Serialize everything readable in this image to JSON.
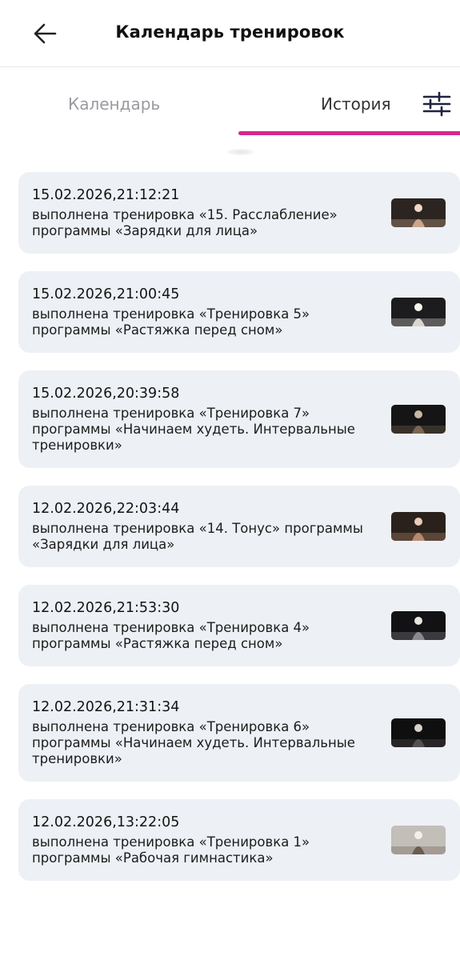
{
  "header": {
    "title": "Календарь тренировок",
    "back_icon": "arrow-left-icon"
  },
  "tabs": [
    {
      "label": "Календарь",
      "active": false
    },
    {
      "label": "История",
      "active": true
    }
  ],
  "filter_icon": "sliders-icon",
  "accent_color": "#d8268f",
  "card_background": "#edf0f5",
  "history": [
    {
      "date": "15.02.2026,21:12:21",
      "text": "выполнена тренировка «15. Расслабление» программы «Зарядки для лица»",
      "thumb": "workout-thumbnail"
    },
    {
      "date": "15.02.2026,21:00:45",
      "text": "выполнена тренировка «Тренировка 5» программы «Растяжка перед сном»",
      "thumb": "workout-thumbnail"
    },
    {
      "date": "15.02.2026,20:39:58",
      "text": "выполнена тренировка «Тренировка 7» программы «Начинаем худеть. Интервальные тренировки»",
      "thumb": "workout-thumbnail"
    },
    {
      "date": "12.02.2026,22:03:44",
      "text": "выполнена тренировка «14. Тонус» программы «Зарядки для лица»",
      "thumb": "workout-thumbnail"
    },
    {
      "date": "12.02.2026,21:53:30",
      "text": "выполнена тренировка «Тренировка 4» программы «Растяжка перед сном»",
      "thumb": "workout-thumbnail"
    },
    {
      "date": "12.02.2026,21:31:34",
      "text": "выполнена тренировка «Тренировка 6» программы «Начинаем худеть. Интервальные тренировки»",
      "thumb": "workout-thumbnail"
    },
    {
      "date": "12.02.2026,13:22:05",
      "text": "выполнена тренировка «Тренировка 1» программы «Рабочая гимнастика»",
      "thumb": "workout-thumbnail"
    }
  ]
}
